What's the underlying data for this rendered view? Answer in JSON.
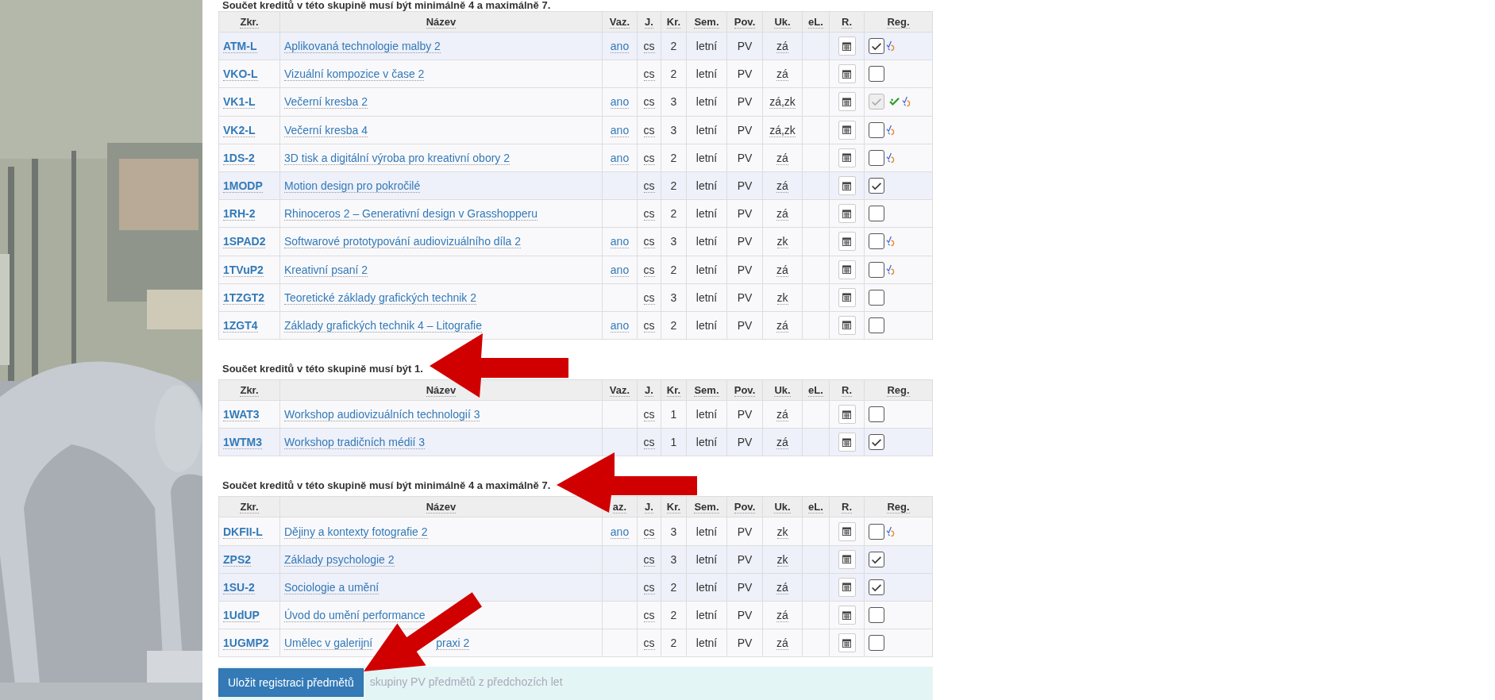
{
  "groups": [
    {
      "heading": "Součet kreditů v této skupině musí být minimálně 4 a maximálně 7.",
      "columns": [
        "Zkr.",
        "Název",
        "Vaz.",
        "J.",
        "Kr.",
        "Sem.",
        "Pov.",
        "Uk.",
        "eL.",
        "R.",
        "Reg."
      ],
      "rows": [
        {
          "code": "ATM-L",
          "name": "Aplikovaná technologie malby 2",
          "binding": "ano",
          "language": "cs",
          "credits": "2",
          "semester": "letní",
          "type": "PV",
          "completion": "zá",
          "checked": true,
          "disabled": false,
          "confirmed": false,
          "alternatives": true
        },
        {
          "code": "VKO-L",
          "name": "Vizuální kompozice v čase 2",
          "language": "cs",
          "credits": "2",
          "semester": "letní",
          "type": "PV",
          "completion": "zá",
          "checked": false,
          "disabled": false,
          "confirmed": false,
          "alternatives": false
        },
        {
          "code": "VK1-L",
          "name": "Večerní kresba 2",
          "binding": "ano",
          "language": "cs",
          "credits": "3",
          "semester": "letní",
          "type": "PV",
          "completion": "zá,zk",
          "checked": true,
          "disabled": true,
          "confirmed": true,
          "alternatives": true
        },
        {
          "code": "VK2-L",
          "name": "Večerní kresba 4",
          "binding": "ano",
          "language": "cs",
          "credits": "3",
          "semester": "letní",
          "type": "PV",
          "completion": "zá,zk",
          "checked": false,
          "disabled": false,
          "confirmed": false,
          "alternatives": true
        },
        {
          "code": "1DS-2",
          "name": "3D tisk a digitální výroba pro kreativní obory 2",
          "binding": "ano",
          "language": "cs",
          "credits": "2",
          "semester": "letní",
          "type": "PV",
          "completion": "zá",
          "checked": false,
          "disabled": false,
          "confirmed": false,
          "alternatives": true
        },
        {
          "code": "1MODP",
          "name": "Motion design pro pokročilé",
          "language": "cs",
          "credits": "2",
          "semester": "letní",
          "type": "PV",
          "completion": "zá",
          "checked": true,
          "disabled": false,
          "confirmed": false,
          "alternatives": false
        },
        {
          "code": "1RH-2",
          "name": "Rhinoceros 2 – Generativní design v Grasshopperu",
          "language": "cs",
          "credits": "2",
          "semester": "letní",
          "type": "PV",
          "completion": "zá",
          "checked": false,
          "disabled": false,
          "confirmed": false,
          "alternatives": false
        },
        {
          "code": "1SPAD2",
          "name": "Softwarové prototypování audiovizuálního díla 2",
          "binding": "ano",
          "language": "cs",
          "credits": "3",
          "semester": "letní",
          "type": "PV",
          "completion": "zk",
          "checked": false,
          "disabled": false,
          "confirmed": false,
          "alternatives": true
        },
        {
          "code": "1TVuP2",
          "name": "Kreativní psaní 2",
          "binding": "ano",
          "language": "cs",
          "credits": "2",
          "semester": "letní",
          "type": "PV",
          "completion": "zá",
          "checked": false,
          "disabled": false,
          "confirmed": false,
          "alternatives": true
        },
        {
          "code": "1TZGT2",
          "name": "Teoretické základy grafických technik 2",
          "language": "cs",
          "credits": "3",
          "semester": "letní",
          "type": "PV",
          "completion": "zk",
          "checked": false,
          "disabled": false,
          "confirmed": false,
          "alternatives": false
        },
        {
          "code": "1ZGT4",
          "name": "Základy grafických technik 4 – Litografie",
          "binding": "ano",
          "language": "cs",
          "credits": "2",
          "semester": "letní",
          "type": "PV",
          "completion": "zá",
          "checked": false,
          "disabled": false,
          "confirmed": false,
          "alternatives": false
        }
      ]
    },
    {
      "heading": "Součet kreditů v této skupině musí být 1.",
      "columns": [
        "Zkr.",
        "Název",
        "Vaz.",
        "J.",
        "Kr.",
        "Sem.",
        "Pov.",
        "Uk.",
        "eL.",
        "R.",
        "Reg."
      ],
      "rows": [
        {
          "code": "1WAT3",
          "name": "Workshop audiovizuálních technologií 3",
          "language": "cs",
          "credits": "1",
          "semester": "letní",
          "type": "PV",
          "completion": "zá",
          "checked": false,
          "disabled": false,
          "confirmed": false,
          "alternatives": false
        },
        {
          "code": "1WTM3",
          "name": "Workshop tradičních médií 3",
          "language": "cs",
          "credits": "1",
          "semester": "letní",
          "type": "PV",
          "completion": "zá",
          "checked": true,
          "disabled": false,
          "confirmed": false,
          "alternatives": false
        }
      ]
    },
    {
      "heading": "Součet kreditů v této skupině musí být minimálně 4 a maximálně 7.",
      "columns": [
        "Zkr.",
        "Název",
        "az.",
        "J.",
        "Kr.",
        "Sem.",
        "Pov.",
        "Uk.",
        "eL.",
        "R.",
        "Reg."
      ],
      "rows": [
        {
          "code": "DKFII-L",
          "name": "Dějiny a kontexty fotografie 2",
          "binding": "ano",
          "language": "cs",
          "credits": "3",
          "semester": "letní",
          "type": "PV",
          "completion": "zk",
          "checked": false,
          "disabled": false,
          "confirmed": false,
          "alternatives": true
        },
        {
          "code": "ZPS2",
          "name": "Základy psychologie 2",
          "language": "cs",
          "credits": "3",
          "semester": "letní",
          "type": "PV",
          "completion": "zk",
          "checked": true,
          "disabled": false,
          "confirmed": false,
          "alternatives": false
        },
        {
          "code": "1SU-2",
          "name": "Sociologie a umění",
          "language": "cs",
          "credits": "2",
          "semester": "letní",
          "type": "PV",
          "completion": "zá",
          "checked": true,
          "disabled": false,
          "confirmed": false,
          "alternatives": false
        },
        {
          "code": "1UdUP",
          "name": "Úvod do umění performance",
          "language": "cs",
          "credits": "2",
          "semester": "letní",
          "type": "PV",
          "completion": "zá",
          "checked": false,
          "disabled": false,
          "confirmed": false,
          "alternatives": false
        },
        {
          "code": "1UGMP2",
          "name": "Umělec v galerijní",
          "name_tail": "praxi 2",
          "language": "cs",
          "credits": "2",
          "semester": "letní",
          "type": "PV",
          "completion": "zá",
          "checked": false,
          "disabled": false,
          "confirmed": false,
          "alternatives": false
        }
      ]
    }
  ],
  "footer": {
    "button": "Uložit registraci předmětů",
    "note": "skupiny PV předmětů z předchozích let"
  }
}
